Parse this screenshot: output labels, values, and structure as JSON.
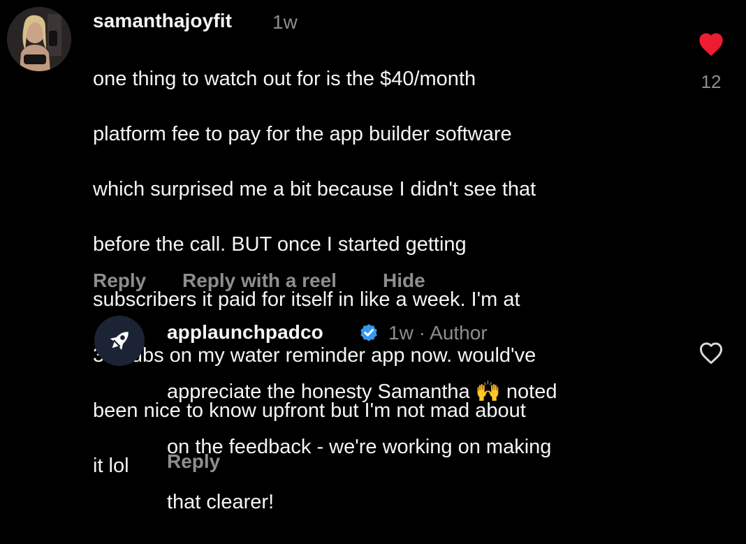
{
  "comment": {
    "username": "samanthajoyfit",
    "time": "1w",
    "lines": [
      "one thing to watch out for is the $40/month",
      "platform fee to pay for the app builder software",
      "which surprised me a bit because I didn't see that",
      "before the call. BUT once I started getting",
      "subscribers it paid for itself in like a week. I'm at",
      "34 subs on my water reminder app now. would've",
      "been nice to know upfront but I'm not mad about",
      "it lol"
    ],
    "actions": {
      "reply": "Reply",
      "reply_reel": "Reply with a reel",
      "hide": "Hide"
    },
    "like_count": "12",
    "liked": true,
    "like_color": "#ed1c33",
    "avatar_icon": "profile-photo"
  },
  "reply": {
    "username": "applaunchpadco",
    "verified": true,
    "verified_color": "#3897f0",
    "time": "1w",
    "separator": "·",
    "role": "Author",
    "lines": [
      "appreciate the honesty Samantha 🙌 noted",
      "on the feedback - we're working on making",
      "that clearer!"
    ],
    "actions": {
      "reply": "Reply"
    },
    "liked": false,
    "avatar_icon": "rocket-icon",
    "avatar_bg": "#1c2334"
  }
}
